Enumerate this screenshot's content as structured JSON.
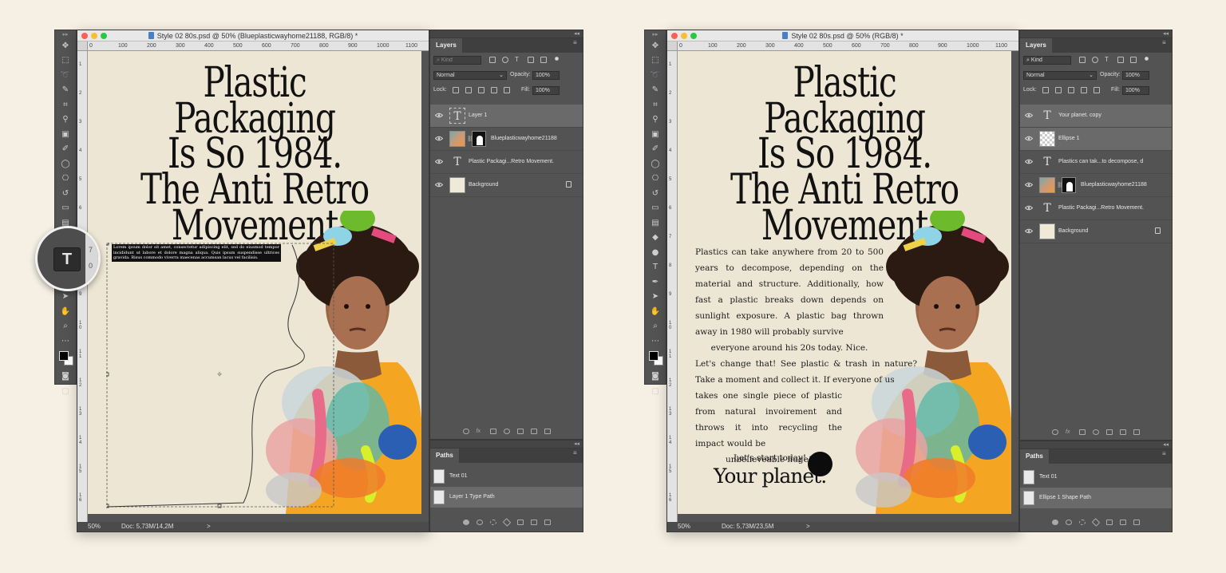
{
  "left": {
    "window_title": "Style 02 80s.psd @ 50% (Blueplasticwayhome21188, RGB/8) *",
    "zoom": "50%",
    "doc_info": "Doc: 5,73M/14,2M",
    "status_arrow": ">",
    "ruler_top": [
      "0",
      "100",
      "200",
      "300",
      "400",
      "500",
      "600",
      "700",
      "800",
      "900",
      "1000",
      "1100"
    ],
    "ruler_left": [
      "1",
      "2",
      "3",
      "4",
      "5",
      "6",
      "7",
      "8",
      "9",
      "1\n0",
      "1\n1",
      "1\n2",
      "1\n3",
      "1\n4",
      "1\n5",
      "1\n6"
    ],
    "headline_lines": [
      "Plastic Packaging",
      "Is So 1984.",
      "The Anti Retro",
      "Movement"
    ],
    "placeholder_text": "Lorem ipsum dolor sit amet, consectetur adipiscing elit, sed do eiusmod tempor incididunt ut labore et dolore magna aliqua. Quis ipsum suspendisse ultrices gravida. Risus commodo viverra maecenas accumsan lacus vel facilisis.",
    "layers_panel": {
      "tab": "Layers",
      "kind": "Kind",
      "blend_mode": "Normal",
      "opacity_label": "Opacity:",
      "opacity_value": "100%",
      "lock_label": "Lock:",
      "fill_label": "Fill:",
      "fill_value": "100%",
      "layers": [
        {
          "name": "Layer 1",
          "type": "text",
          "selected": true
        },
        {
          "name": "Blueplasticwayhome21188",
          "type": "image",
          "selected": false
        },
        {
          "name": "Plastic Packagi...Retro Movement.",
          "type": "text",
          "selected": false
        },
        {
          "name": "Background",
          "type": "background",
          "selected": false
        }
      ]
    },
    "paths_panel": {
      "tab": "Paths",
      "paths": [
        {
          "name": "Text 01",
          "selected": false
        },
        {
          "name": "Layer 1 Type Path",
          "selected": true
        }
      ]
    },
    "magnifier_ruler": [
      "7",
      "0"
    ]
  },
  "right": {
    "window_title": "Style 02 80s.psd @ 50% (RGB/8) *",
    "zoom": "50%",
    "doc_info": "Doc: 5,73M/23,5M",
    "status_arrow": ">",
    "ruler_top": [
      "0",
      "100",
      "200",
      "300",
      "400",
      "500",
      "600",
      "700",
      "800",
      "900",
      "1000",
      "1100"
    ],
    "ruler_left": [
      "1",
      "2",
      "3",
      "4",
      "5",
      "6",
      "7",
      "8",
      "9",
      "1\n0",
      "1\n1",
      "1\n2",
      "1\n3",
      "1\n4",
      "1\n5",
      "1\n6"
    ],
    "headline_lines": [
      "Plastic Packaging",
      "Is So 1984.",
      "The Anti Retro",
      "Movement"
    ],
    "body_para1": "Plastics can take anywhere from 20 to 500 years to decompose, depending on the material and structure. Additionally, how fast a plastic breaks down depends on sunlight exposure. A plastic bag thrown away in 1980 will probably survive",
    "body_para1_last": "everyone around his 20s today. Nice.",
    "body_para2_wide": "Let's change that! See plastic & trash in nature? Take a moment and collect it. If everyone of us",
    "body_para2_narrow": "takes one single piece of plastic from natural invoirement and throws it into recycling the impact would be",
    "body_para2_last": "unbelieveable huge!",
    "cta_small": "Let's start today!",
    "cta_big": "Your planet.",
    "layers_panel": {
      "tab": "Layers",
      "kind": "Kind",
      "blend_mode": "Normal",
      "opacity_label": "Opacity:",
      "opacity_value": "100%",
      "lock_label": "Lock:",
      "fill_label": "Fill:",
      "fill_value": "100%",
      "layers": [
        {
          "name": "Your planet. copy",
          "type": "text",
          "selected": true
        },
        {
          "name": "Ellipse 1",
          "type": "shape",
          "selected": true
        },
        {
          "name": "Plastics can tak...to decompose, d",
          "type": "text",
          "selected": false
        },
        {
          "name": "Blueplasticwayhome21188",
          "type": "image",
          "selected": false
        },
        {
          "name": "Plastic Packagi...Retro Movement.",
          "type": "text",
          "selected": false
        },
        {
          "name": "Background",
          "type": "background",
          "selected": false
        }
      ]
    },
    "paths_panel": {
      "tab": "Paths",
      "paths": [
        {
          "name": "Text 01",
          "selected": false
        },
        {
          "name": "Ellipse 1 Shape Path",
          "selected": true
        }
      ]
    }
  },
  "colors": {
    "page_bg": "#f5f0e3",
    "canvas_bg": "#ede6d4",
    "panel_bg": "#535353",
    "selected_row": "#6a6a6a"
  }
}
